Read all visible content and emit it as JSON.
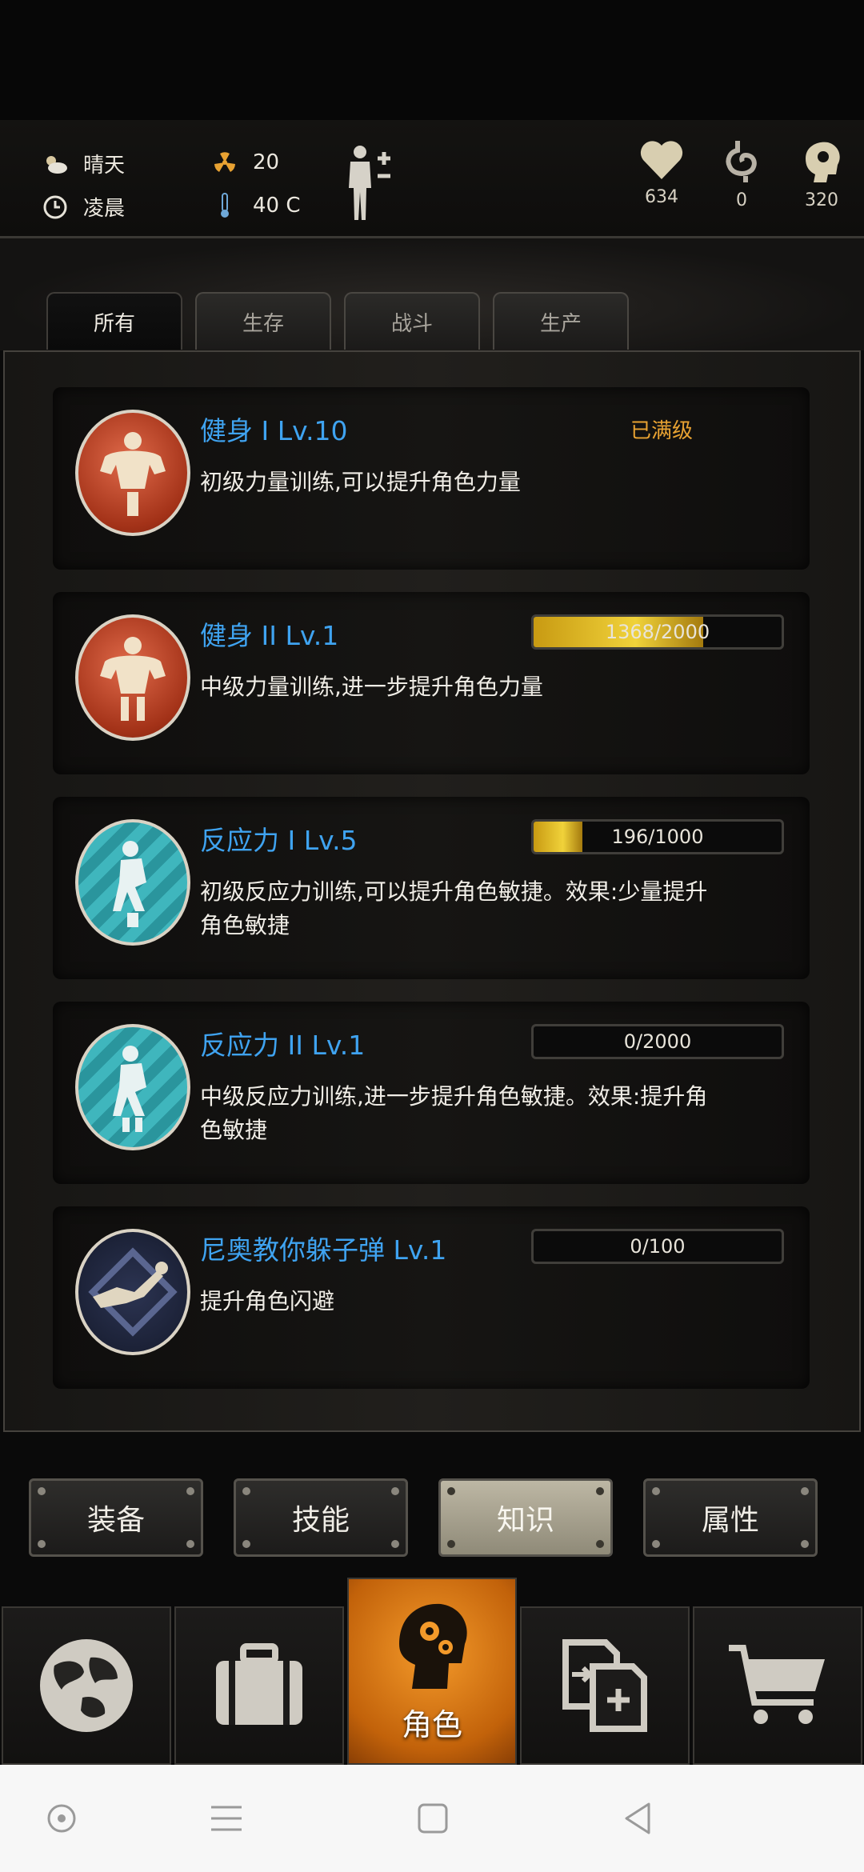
{
  "header": {
    "weather": "晴天",
    "time": "凌晨",
    "radiation": "20",
    "temperature": "40 C",
    "stats": [
      {
        "icon": "heart-icon",
        "value": "634"
      },
      {
        "icon": "stomach-icon",
        "value": "0"
      },
      {
        "icon": "brain-head-icon",
        "value": "320"
      }
    ]
  },
  "tabs": [
    "所有",
    "生存",
    "战斗",
    "生产"
  ],
  "skills": [
    {
      "title": "健身 I Lv.10",
      "desc": "初级力量训练,可以提升角色力量",
      "status": "已满级",
      "progress": null
    },
    {
      "title": "健身 II Lv.1",
      "desc": "中级力量训练,进一步提升角色力量",
      "status": "",
      "progress": "1368/2000",
      "fraction": 0.684
    },
    {
      "title": "反应力 I Lv.5",
      "desc": "初级反应力训练,可以提升角色敏捷。效果:少量提升角色敏捷",
      "status": "",
      "progress": "196/1000",
      "fraction": 0.196
    },
    {
      "title": "反应力 II Lv.1",
      "desc": "中级反应力训练,进一步提升角色敏捷。效果:提升角色敏捷",
      "status": "",
      "progress": "0/2000",
      "fraction": 0
    },
    {
      "title": "尼奥教你躲子弹 Lv.1",
      "desc": "提升角色闪避",
      "status": "",
      "progress": "0/100",
      "fraction": 0
    }
  ],
  "sub_buttons": [
    "装备",
    "技能",
    "知识",
    "属性"
  ],
  "nav": {
    "active_label": "角色"
  },
  "colors": {
    "accent": "#f49a2a",
    "skill_title": "#3fa3f0",
    "maxed": "#e8a232",
    "bar_fill": "#f0d23a"
  }
}
